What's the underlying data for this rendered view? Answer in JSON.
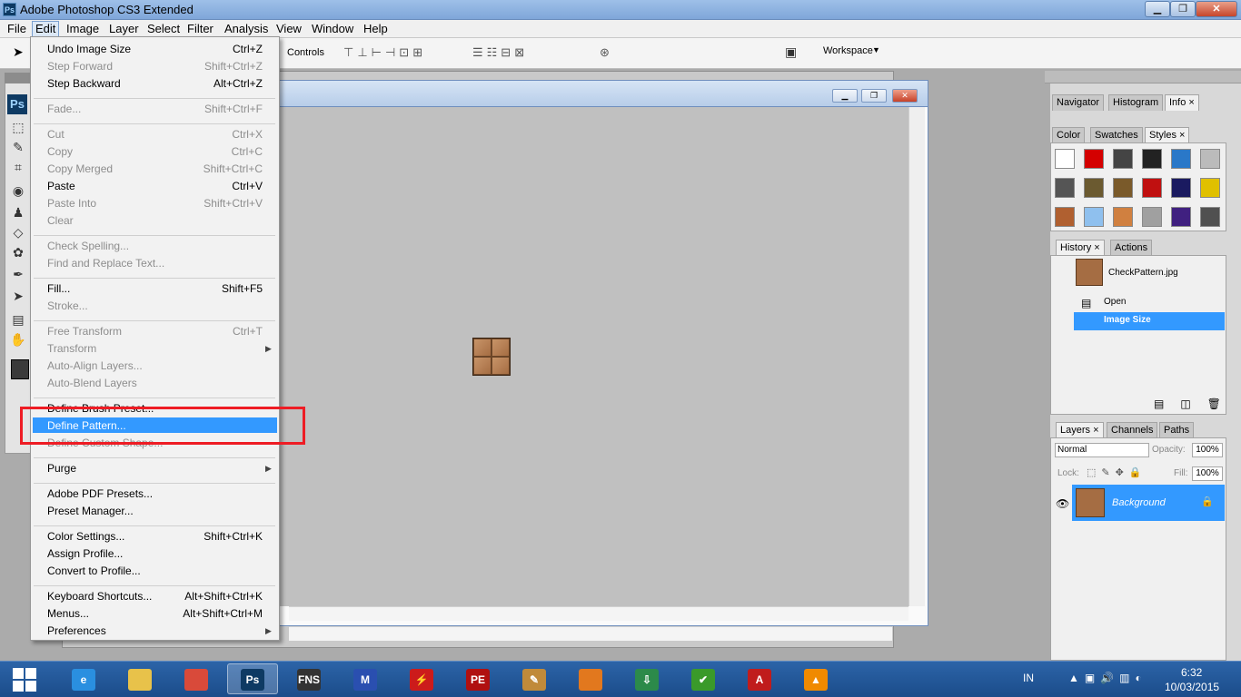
{
  "app": {
    "title": "Adobe Photoshop CS3 Extended",
    "icon": "Ps"
  },
  "window_controls": {
    "minimize": "▁",
    "restore": "❐",
    "close": "✕"
  },
  "menubar": [
    "File",
    "Edit",
    "Image",
    "Layer",
    "Select",
    "Filter",
    "Analysis",
    "View",
    "Window",
    "Help"
  ],
  "options_bar": {
    "controls_label": "Controls",
    "workspace_label": "Workspace",
    "workspace_arrow": "▼"
  },
  "toolbox": {
    "logo": "Ps"
  },
  "edit_menu": {
    "groups": [
      [
        {
          "label": "Undo Image Size",
          "shortcut": "Ctrl+Z",
          "enabled": true
        },
        {
          "label": "Step Forward",
          "shortcut": "Shift+Ctrl+Z",
          "enabled": false
        },
        {
          "label": "Step Backward",
          "shortcut": "Alt+Ctrl+Z",
          "enabled": true
        }
      ],
      [
        {
          "label": "Fade...",
          "shortcut": "Shift+Ctrl+F",
          "enabled": false
        }
      ],
      [
        {
          "label": "Cut",
          "shortcut": "Ctrl+X",
          "enabled": false
        },
        {
          "label": "Copy",
          "shortcut": "Ctrl+C",
          "enabled": false
        },
        {
          "label": "Copy Merged",
          "shortcut": "Shift+Ctrl+C",
          "enabled": false
        },
        {
          "label": "Paste",
          "shortcut": "Ctrl+V",
          "enabled": true
        },
        {
          "label": "Paste Into",
          "shortcut": "Shift+Ctrl+V",
          "enabled": false
        },
        {
          "label": "Clear",
          "shortcut": "",
          "enabled": false
        }
      ],
      [
        {
          "label": "Check Spelling...",
          "shortcut": "",
          "enabled": false
        },
        {
          "label": "Find and Replace Text...",
          "shortcut": "",
          "enabled": false
        }
      ],
      [
        {
          "label": "Fill...",
          "shortcut": "Shift+F5",
          "enabled": true
        },
        {
          "label": "Stroke...",
          "shortcut": "",
          "enabled": false
        }
      ],
      [
        {
          "label": "Free Transform",
          "shortcut": "Ctrl+T",
          "enabled": false
        },
        {
          "label": "Transform",
          "shortcut": "",
          "enabled": false,
          "submenu": true
        },
        {
          "label": "Auto-Align Layers...",
          "shortcut": "",
          "enabled": false
        },
        {
          "label": "Auto-Blend Layers",
          "shortcut": "",
          "enabled": false
        }
      ],
      [
        {
          "label": "Define Brush Preset...",
          "shortcut": "",
          "enabled": true
        },
        {
          "label": "Define Pattern...",
          "shortcut": "",
          "enabled": true,
          "highlighted": true
        },
        {
          "label": "Define Custom Shape...",
          "shortcut": "",
          "enabled": false
        }
      ],
      [
        {
          "label": "Purge",
          "shortcut": "",
          "enabled": true,
          "submenu": true
        }
      ],
      [
        {
          "label": "Adobe PDF Presets...",
          "shortcut": "",
          "enabled": true
        },
        {
          "label": "Preset Manager...",
          "shortcut": "",
          "enabled": true
        }
      ],
      [
        {
          "label": "Color Settings...",
          "shortcut": "Shift+Ctrl+K",
          "enabled": true
        },
        {
          "label": "Assign Profile...",
          "shortcut": "",
          "enabled": true
        },
        {
          "label": "Convert to Profile...",
          "shortcut": "",
          "enabled": true
        }
      ],
      [
        {
          "label": "Keyboard Shortcuts...",
          "shortcut": "Alt+Shift+Ctrl+K",
          "enabled": true
        },
        {
          "label": "Menus...",
          "shortcut": "Alt+Shift+Ctrl+M",
          "enabled": true
        },
        {
          "label": "Preferences",
          "shortcut": "",
          "enabled": true,
          "submenu": true
        }
      ]
    ]
  },
  "panels": {
    "nav_tabs": [
      "Navigator",
      "Histogram",
      "Info ×"
    ],
    "style_tabs": [
      "Color",
      "Swatches",
      "Styles ×"
    ],
    "history_tabs": [
      "History ×",
      "Actions"
    ],
    "history": {
      "snapshot": "CheckPattern.jpg",
      "states": [
        "Open",
        "Image Size"
      ]
    },
    "layer_tabs": [
      "Layers ×",
      "Channels",
      "Paths"
    ],
    "layers": {
      "blend_mode": "Normal",
      "opacity_label": "Opacity:",
      "opacity": "100%",
      "lock_label": "Lock:",
      "fill_label": "Fill:",
      "fill": "100%",
      "layer_name": "Background"
    }
  },
  "style_colors": [
    "#ffffff",
    "#d40000",
    "#444444",
    "#222222",
    "#2a78c8",
    "#bbbbbb",
    "#555555",
    "#6b5a30",
    "#7a5a2a",
    "#c01010",
    "#1a1a60",
    "#e0c000",
    "#b06030",
    "#8fc0ee",
    "#d08040",
    "#a0a0a0",
    "#402080",
    "#505050"
  ],
  "taskbar": {
    "lang": "IN",
    "time": "6:32",
    "date": "10/03/2015"
  },
  "colors": {
    "accent": "#3399ff",
    "highlight_box": "#ee1c24",
    "taskbar": "#1b4c8a"
  }
}
